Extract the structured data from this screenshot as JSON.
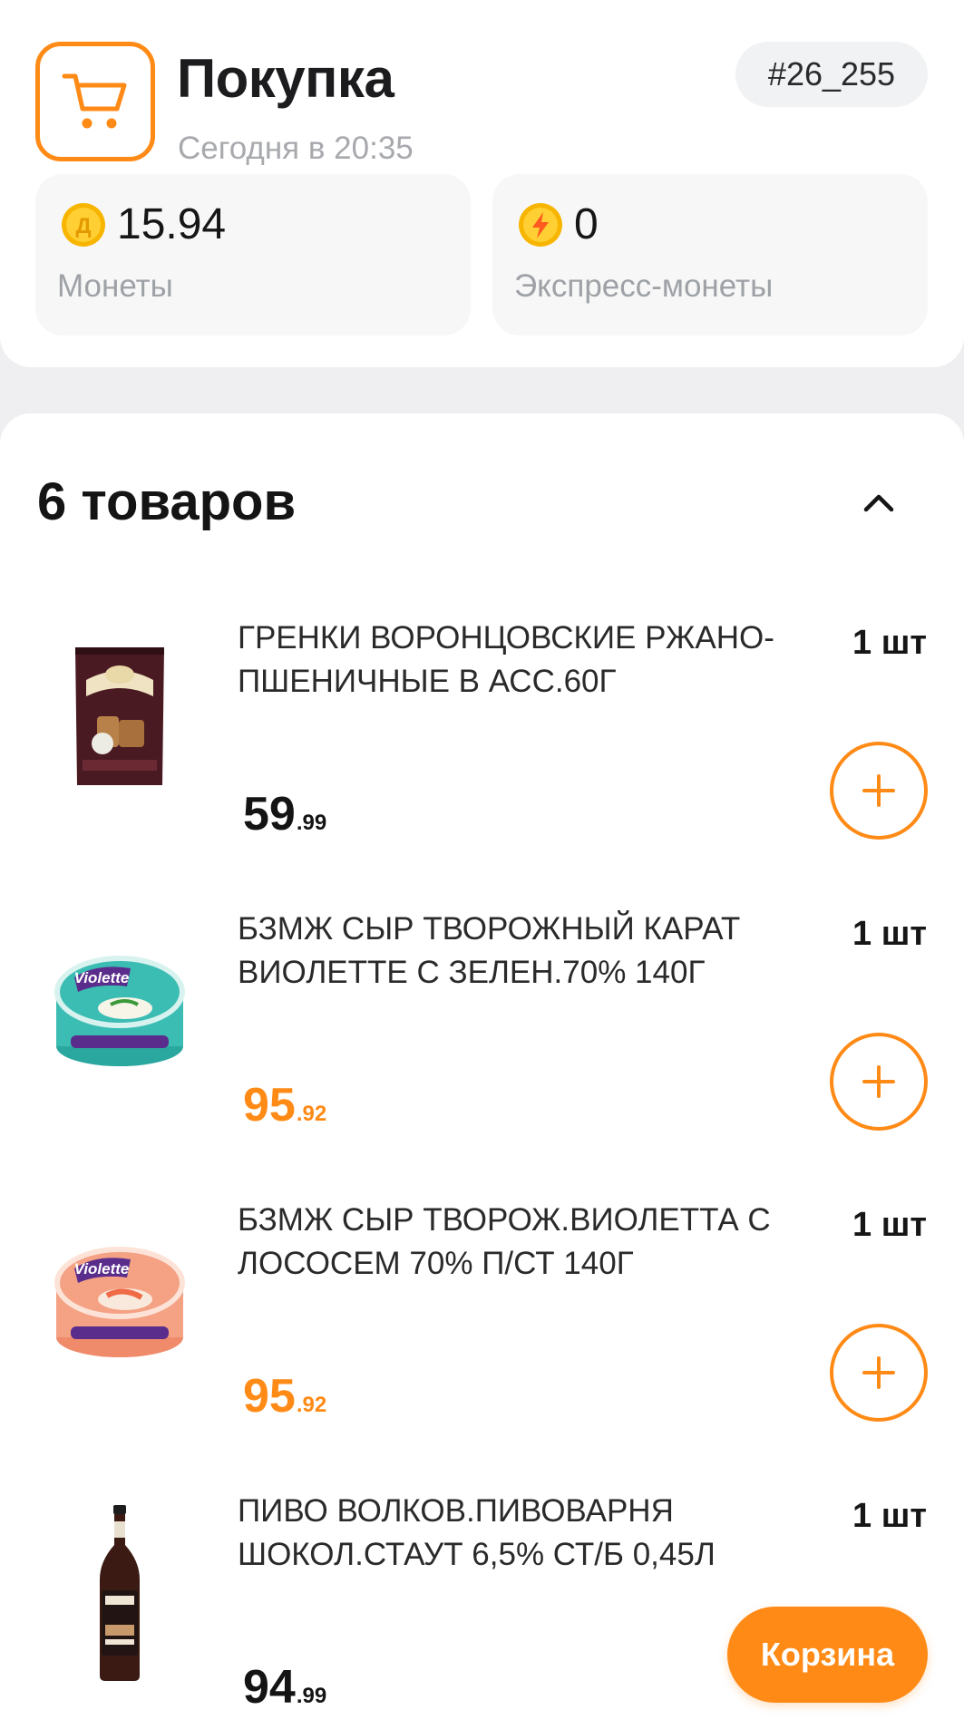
{
  "header": {
    "title": "Покупка",
    "subtitle": "Сегодня в 20:35",
    "order_number": "#26_255",
    "icon": "cart-icon"
  },
  "coins": [
    {
      "value": "15.94",
      "label": "Монеты",
      "icon": "coin-d-icon",
      "color": "#ffc21a",
      "glyph": "Д"
    },
    {
      "value": "0",
      "label": "Экспресс-монеты",
      "icon": "lightning-coin-icon",
      "color": "#ffb21a"
    }
  ],
  "list": {
    "title": "6 товаров",
    "items": [
      {
        "name": "ГРЕНКИ ВОРОНЦОВСКИЕ РЖАНО-ПШЕНИЧНЫЕ В АСС.60Г",
        "qty": "1 шт",
        "price_main": "59",
        "price_cents": ".99",
        "accent": false
      },
      {
        "name": "БЗМЖ СЫР ТВОРОЖНЫЙ КАРАТ ВИОЛЕТТЕ С ЗЕЛЕН.70% 140Г",
        "qty": "1 шт",
        "price_main": "95",
        "price_cents": ".92",
        "accent": true,
        "brand": "Violette"
      },
      {
        "name": "БЗМЖ СЫР ТВОРОЖ.ВИОЛЕТТА С ЛОСОСЕМ 70% П/СТ 140Г",
        "qty": "1 шт",
        "price_main": "95",
        "price_cents": ".92",
        "accent": true,
        "brand": "Violette"
      },
      {
        "name": "ПИВО ВОЛКОВ.ПИВОВАРНЯ ШОКОЛ.СТАУТ 6,5% СТ/Б 0,45Л",
        "qty": "1 шт",
        "price_main": "94",
        "price_cents": ".99",
        "accent": false
      }
    ]
  },
  "basket_button": "Корзина",
  "colors": {
    "accent": "#ff8a16",
    "muted": "#a7a9ad",
    "chip_bg": "#f1f2f4"
  }
}
